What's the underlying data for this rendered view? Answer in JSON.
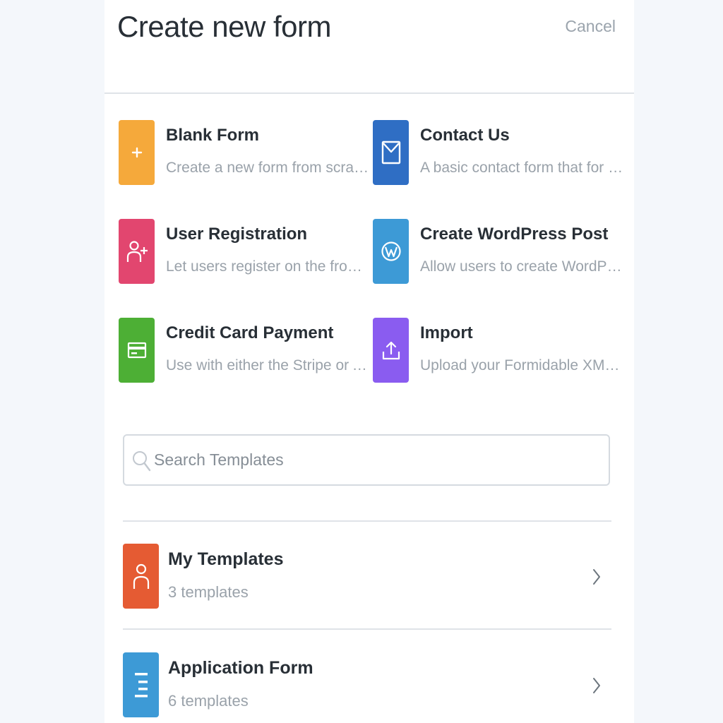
{
  "header": {
    "title": "Create new form",
    "cancel_label": "Cancel"
  },
  "options": [
    {
      "title": "Blank Form",
      "description": "Create a new form from scratch",
      "icon": "plus-icon",
      "color": "#f5a93b"
    },
    {
      "title": "Contact Us",
      "description": "A basic contact form that for any …",
      "icon": "envelope-icon",
      "color": "#2f6ec4"
    },
    {
      "title": "User Registration",
      "description": "Let users register on the front-end…",
      "icon": "user-add-icon",
      "color": "#e2466f"
    },
    {
      "title": "Create WordPress Post",
      "description": "Allow users to create WordPress p…",
      "icon": "wordpress-icon",
      "color": "#3d9ad6"
    },
    {
      "title": "Credit Card Payment",
      "description": "Use with either the Stripe or Autho…",
      "icon": "credit-card-icon",
      "color": "#4daf35"
    },
    {
      "title": "Import",
      "description": "Upload your Formidable XML or C…",
      "icon": "upload-icon",
      "color": "#8a5cf0"
    }
  ],
  "search": {
    "placeholder": "Search Templates",
    "value": ""
  },
  "template_categories": [
    {
      "name": "My Templates",
      "count": "3 templates",
      "icon": "user-icon",
      "color": "#e55b33"
    },
    {
      "name": "Application Form",
      "count": "6 templates",
      "icon": "list-icon",
      "color": "#3d9ad6"
    }
  ],
  "colors": {
    "divider": "#dfe3e8",
    "title_text": "#282f36",
    "muted_text": "#9aa2aa",
    "page_background": "#f4f7fb"
  }
}
